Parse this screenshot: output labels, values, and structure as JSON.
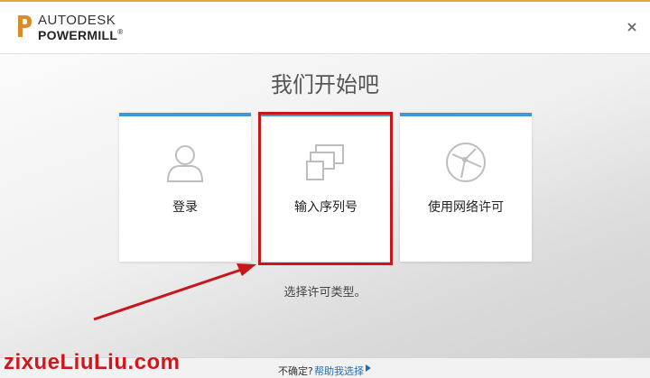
{
  "header": {
    "brand_top": "AUTODESK",
    "brand_bottom": "POWERMILL",
    "brand_bottom_suffix": "®",
    "close_icon": "close-icon"
  },
  "main": {
    "heading": "我们开始吧",
    "cards": [
      {
        "label": "登录",
        "icon": "user-icon"
      },
      {
        "label": "输入序列号",
        "icon": "devices-icon",
        "highlighted": true
      },
      {
        "label": "使用网络许可",
        "icon": "globe-network-icon"
      }
    ],
    "hint": "选择许可类型。"
  },
  "footer": {
    "question": "不确定?",
    "link": "帮助我选择"
  },
  "watermark": "zixueLiuLiu.com",
  "colors": {
    "accent_bar": "#3b9ad6",
    "highlight": "#c8171b",
    "link": "#1f6fb5",
    "brand_orange": "#e8a53c"
  }
}
